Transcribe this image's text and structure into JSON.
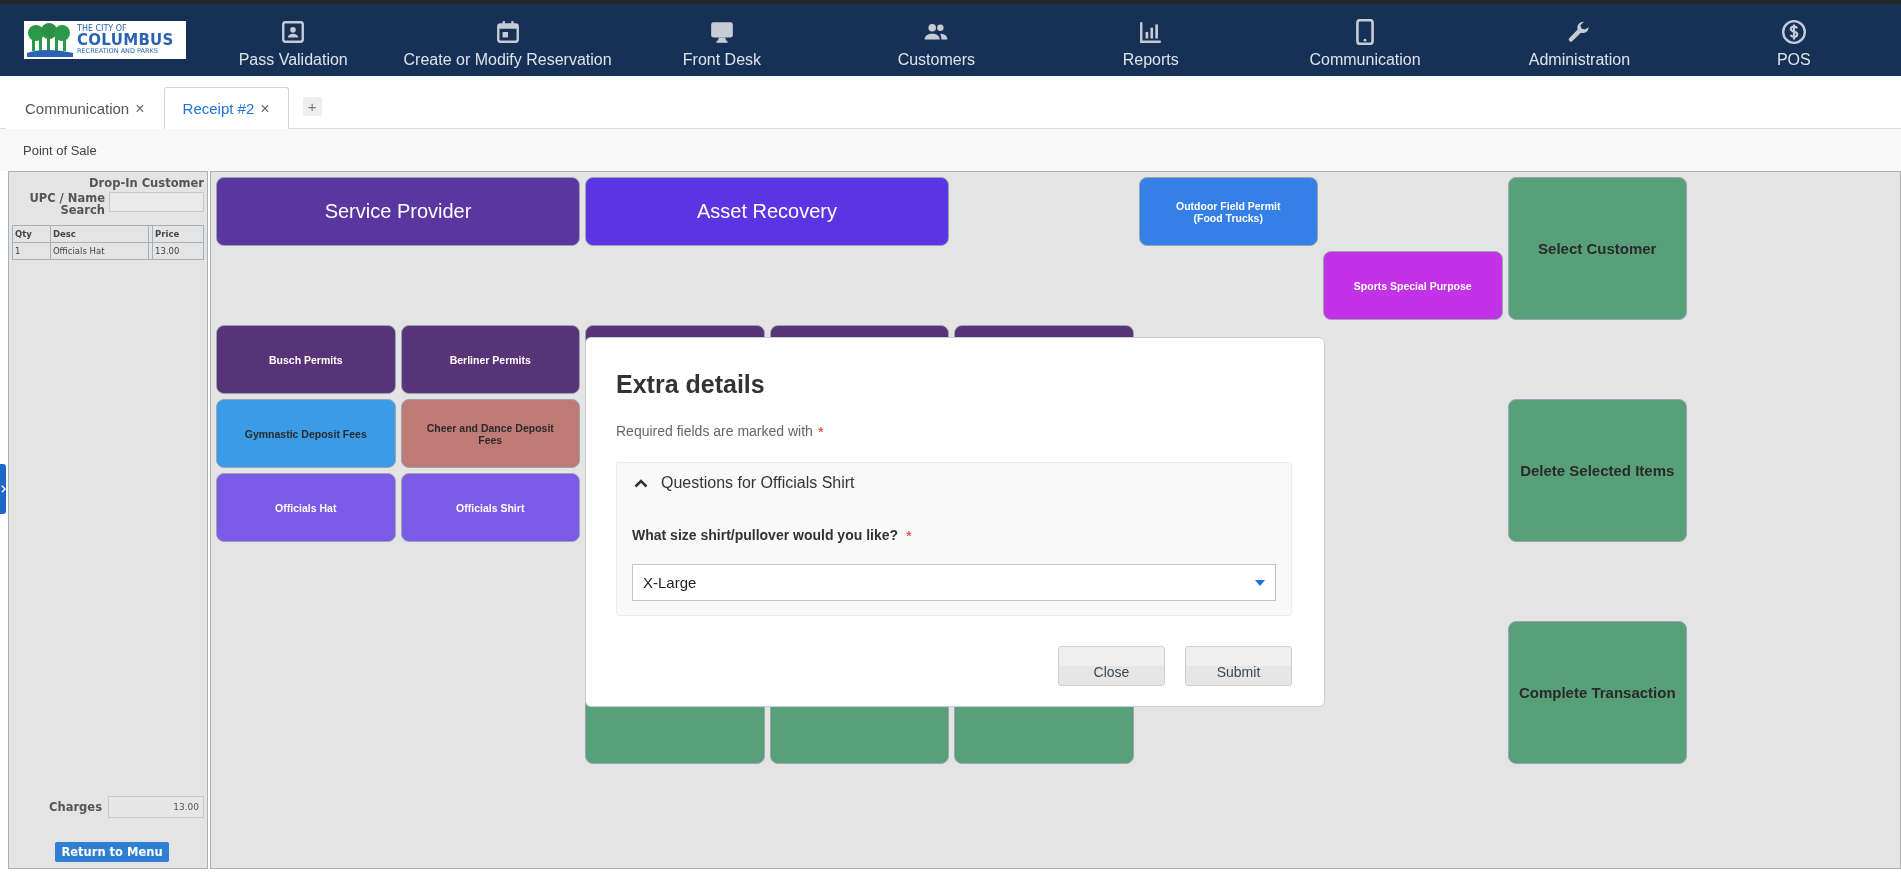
{
  "header": {
    "logo": {
      "lines": [
        "THE CITY OF",
        "COLUMBUS",
        "RECREATION AND PARKS"
      ]
    },
    "nav": [
      {
        "label": "Pass Validation"
      },
      {
        "label": "Create or Modify Reservation"
      },
      {
        "label": "Front Desk"
      },
      {
        "label": "Customers"
      },
      {
        "label": "Reports"
      },
      {
        "label": "Communication"
      },
      {
        "label": "Administration"
      },
      {
        "label": "POS"
      }
    ]
  },
  "tabs": [
    {
      "label": "Communication",
      "selected": false,
      "close": "×"
    },
    {
      "label": "Receipt #2",
      "selected": true,
      "close": "×"
    }
  ],
  "add_tab": "+",
  "breadcrumb": "Point of Sale",
  "sidebar": {
    "customer": "Drop-In Customer",
    "search_label": "UPC / Name Search",
    "table": {
      "columns": [
        {
          "kind": "text",
          "label": "Qty"
        },
        {
          "kind": "text",
          "label": "Desc"
        },
        {
          "kind": "spacer"
        },
        {
          "kind": "text",
          "label": "Price"
        }
      ],
      "rows": [
        [
          "1",
          "Officials Hat",
          null,
          "13.00"
        ]
      ]
    },
    "charges_label": "Charges",
    "charges_value": "13.00",
    "return_button": "Return to Menu"
  },
  "tiles": [
    {
      "kind": "category",
      "label": "Service Provider",
      "color": "#5a36a0"
    },
    {
      "kind": "category",
      "label": "Asset Recovery",
      "color": "#5b34e4"
    },
    {
      "kind": "item",
      "label": "Outdoor Field Permit (Food Trucks)",
      "color": "#3580e6"
    },
    {
      "kind": "action",
      "label": "Select Customer",
      "color": "#58a07a"
    },
    {
      "kind": "item",
      "label": "Sports Special Purpose",
      "color": "#c232e6"
    },
    {
      "kind": "item",
      "label": "Busch Permits",
      "color": "#583377"
    },
    {
      "kind": "item",
      "label": "Berliner Permits",
      "color": "#583377"
    },
    {
      "kind": "item",
      "color": "#583377"
    },
    {
      "kind": "item",
      "color": "#583377"
    },
    {
      "kind": "item",
      "color": "#583377"
    },
    {
      "kind": "item",
      "label": "Gymnastic Deposit Fees",
      "color": "#3a9be6"
    },
    {
      "kind": "item",
      "label": "Cheer and Dance Deposit Fees",
      "color": "#c07a76"
    },
    {
      "kind": "action",
      "label": "Delete Selected Items",
      "color": "#58a07a"
    },
    {
      "kind": "item",
      "label": "Officials Hat",
      "color": "#7a5ae6"
    },
    {
      "kind": "item",
      "label": "Officials Shirt",
      "color": "#7a5ae6"
    },
    {
      "kind": "action",
      "color": "#58a07a"
    },
    {
      "kind": "action",
      "color": "#58a07a"
    },
    {
      "kind": "action",
      "color": "#58a07a"
    },
    {
      "kind": "action",
      "label": "Complete Transaction",
      "color": "#58a07a"
    }
  ],
  "modal": {
    "title": "Extra details",
    "required_note": "Required fields are marked with",
    "required_mark": "*",
    "section": {
      "title": "Questions for Officials Shirt",
      "expanded": true,
      "question": {
        "label": "What size shirt/pullover would you like?",
        "required_mark": "*",
        "value": "X-Large"
      }
    },
    "buttons": [
      "Close",
      "Submit"
    ]
  }
}
